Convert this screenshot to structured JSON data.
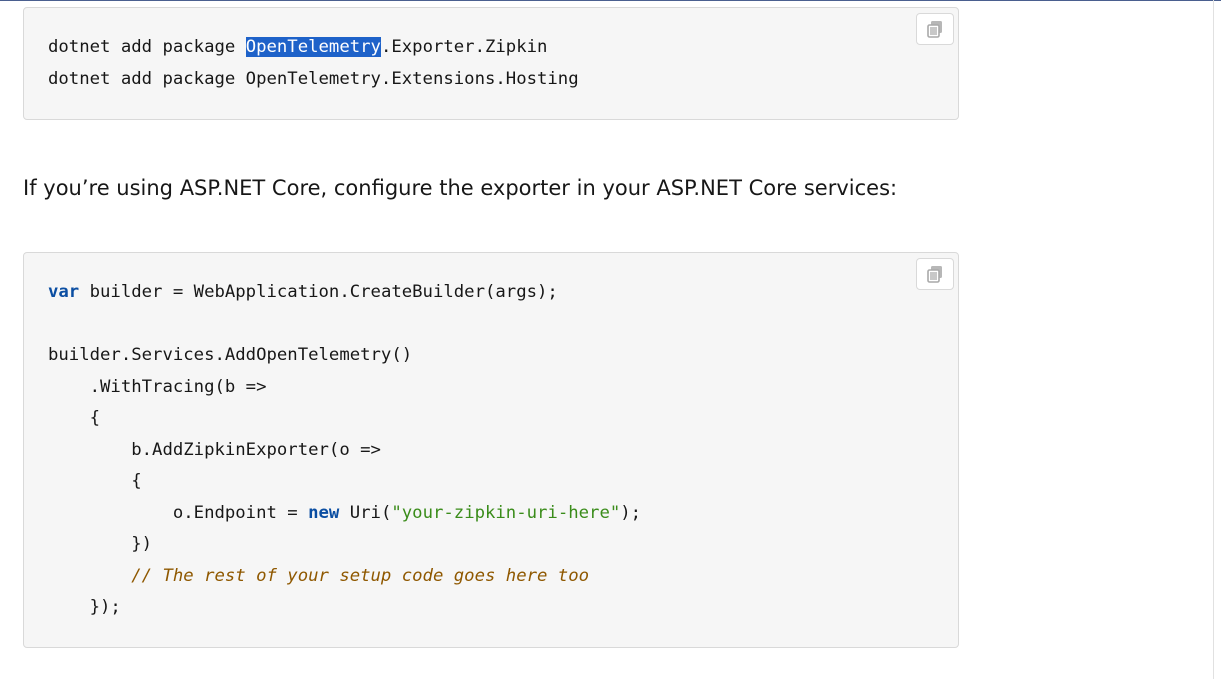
{
  "block1": {
    "copy_icon": "copy-icon",
    "line1": {
      "prefix": "dotnet add package ",
      "selected": "OpenTelemetry",
      "suffix": ".Exporter.Zipkin"
    },
    "line2": "dotnet add package OpenTelemetry.Extensions.Hosting"
  },
  "paragraph": "If you’re using ASP.NET Core, configure the exporter in your ASP.NET Core services:",
  "block2": {
    "copy_icon": "copy-icon",
    "l1_kw": "var",
    "l1_rest": " builder = WebApplication.CreateBuilder(args);",
    "l3": "builder.Services.AddOpenTelemetry()",
    "l4": "    .WithTracing(b =>",
    "l5": "    {",
    "l6": "        b.AddZipkinExporter(o =>",
    "l7": "        {",
    "l8_pre": "            o.Endpoint = ",
    "l8_kw": "new",
    "l8_mid": " Uri(",
    "l8_str": "\"your-zipkin-uri-here\"",
    "l8_end": ");",
    "l9": "        })",
    "l10_indent": "        ",
    "l10_comment": "// The rest of your setup code goes here too",
    "l11": "    });"
  },
  "colors": {
    "selection": "#1e62c9",
    "keyword": "#0b4ea2",
    "string": "#3a8c1a",
    "comment": "#8f5800",
    "code_bg": "#f6f6f6"
  }
}
